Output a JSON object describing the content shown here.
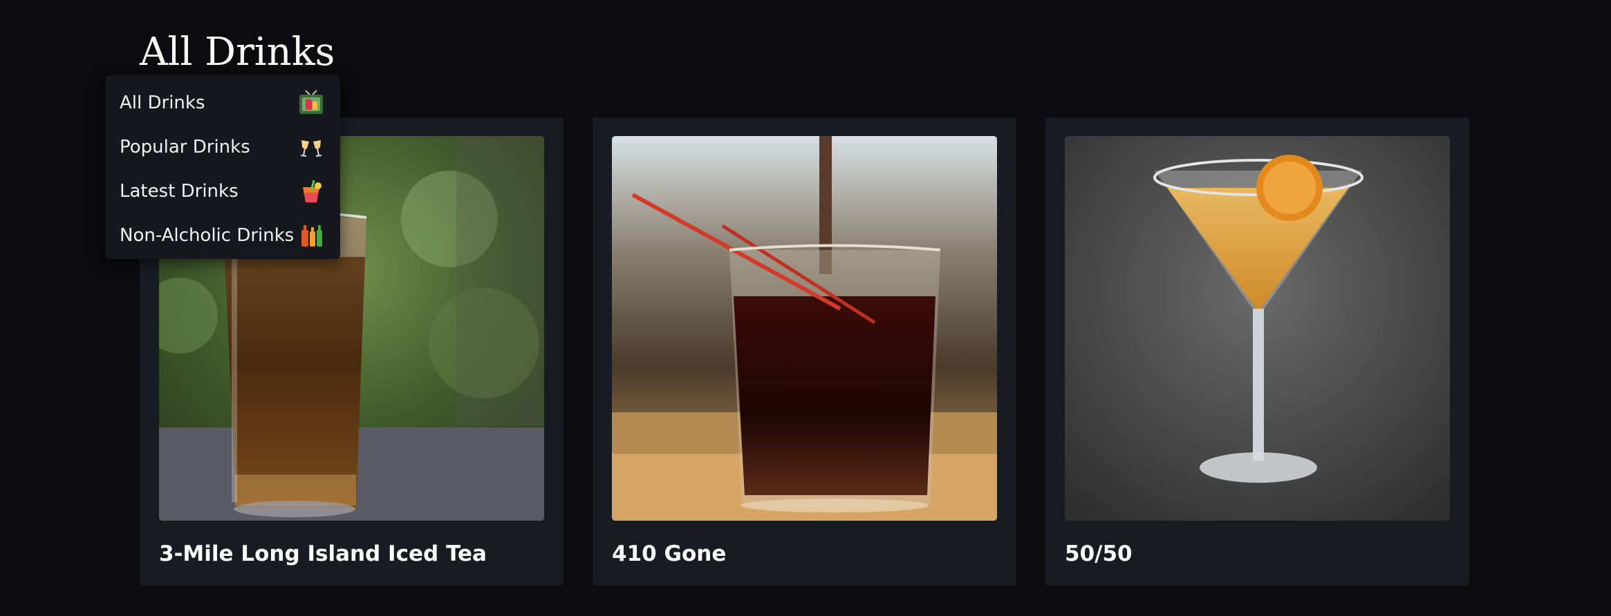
{
  "page": {
    "title": "All Drinks"
  },
  "menu": {
    "items": [
      {
        "label": "All Drinks",
        "icon": "tv-drinks-icon"
      },
      {
        "label": "Popular Drinks",
        "icon": "clinking-glasses-icon"
      },
      {
        "label": "Latest Drinks",
        "icon": "tropical-drink-icon"
      },
      {
        "label": "Non-Alcholic Drinks",
        "icon": "soda-bottles-icon"
      }
    ]
  },
  "drinks": [
    {
      "name": "3-Mile Long Island Iced Tea",
      "image": "iced-tea-glass-photo"
    },
    {
      "name": "410 Gone",
      "image": "dark-drink-tumbler-photo"
    },
    {
      "name": "50/50",
      "image": "martini-orange-slice-photo"
    }
  ],
  "colors": {
    "background": "#0c0c0e",
    "card": "#191b22",
    "menu": "#16181e",
    "text": "#ffffff"
  }
}
